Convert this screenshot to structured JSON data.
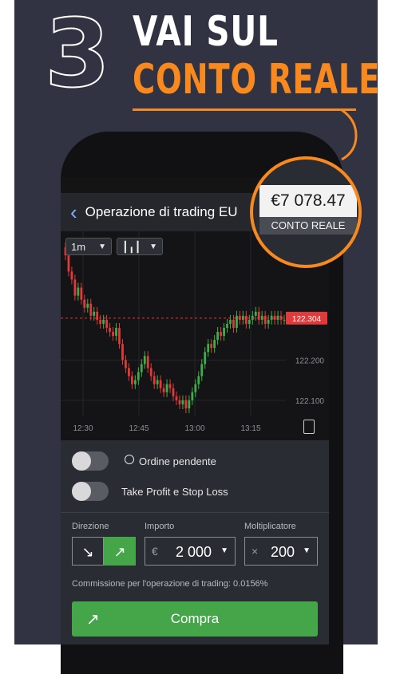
{
  "banner": {
    "step_number": "3",
    "line1": "VAI SUL",
    "line2": "CONTO REALE",
    "accent_color": "#f7891f"
  },
  "app": {
    "back_icon": "chevron-left-icon",
    "title": "Operazione di trading EU",
    "timeframe": "1m",
    "chart_type_icon": "candlestick-icon"
  },
  "balance_callout": {
    "amount": "€7 078.47",
    "account_type": "CONTO REALE"
  },
  "chart_data": {
    "type": "candlestick",
    "x_ticks": [
      "12:30",
      "12:45",
      "13:00",
      "13:15"
    ],
    "y_ticks": [
      "122.200",
      "122.100"
    ],
    "current_price": "122.304",
    "colors": {
      "up": "#3fae49",
      "down": "#e2393a",
      "price_line": "#e2393a"
    },
    "closes": [
      122.46,
      122.42,
      122.4,
      122.36,
      122.38,
      122.35,
      122.33,
      122.34,
      122.31,
      122.32,
      122.3,
      122.29,
      122.3,
      122.28,
      122.27,
      122.26,
      122.28,
      122.24,
      122.2,
      122.18,
      122.16,
      122.14,
      122.15,
      122.17,
      122.19,
      122.21,
      122.18,
      122.16,
      122.14,
      122.15,
      122.13,
      122.12,
      122.14,
      122.13,
      122.11,
      122.1,
      122.09,
      122.1,
      122.08,
      122.1,
      122.12,
      122.14,
      122.16,
      122.19,
      122.22,
      122.24,
      122.23,
      122.25,
      122.27,
      122.26,
      122.28,
      122.29,
      122.3,
      122.28,
      122.31,
      122.3,
      122.31,
      122.29,
      122.3,
      122.31,
      122.32,
      122.3,
      122.31,
      122.29,
      122.3,
      122.31,
      122.3,
      122.31,
      122.3,
      122.3
    ],
    "ylim": [
      122.06,
      122.5
    ]
  },
  "orders": {
    "pending_order_icon": "stopwatch-icon",
    "pending_order_label": "Ordine pendente",
    "tp_sl_label": "Take Profit e Stop Loss"
  },
  "trade_form": {
    "direction_label": "Direzione",
    "direction_down_icon": "arrow-down-right-icon",
    "direction_up_icon": "arrow-up-right-icon",
    "amount_label": "Importo",
    "currency_symbol": "€",
    "amount_value": "2 000",
    "multiplier_label": "Moltiplicatore",
    "multiplier_symbol": "×",
    "multiplier_value": "200",
    "commission_text": "Commissione per l'operazione di trading: 0.0156%",
    "buy_icon": "arrow-up-right-icon",
    "buy_label": "Compra",
    "buy_color": "#45a649"
  }
}
